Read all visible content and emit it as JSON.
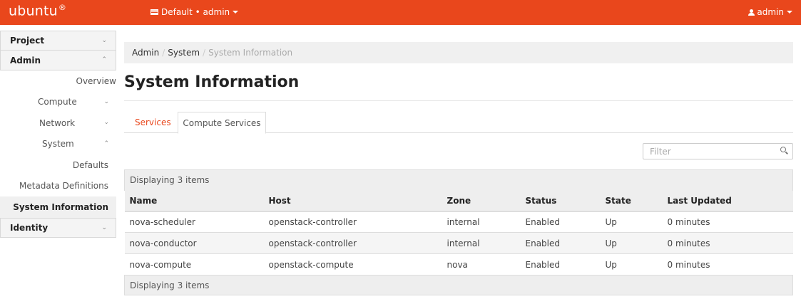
{
  "topbar": {
    "brand": "ubuntu",
    "brand_mark": "®",
    "context": "Default • admin",
    "user": "admin",
    "colors": {
      "accent": "#e9471c"
    }
  },
  "sidebar": {
    "sections": {
      "project": "Project",
      "admin": "Admin",
      "identity": "Identity"
    },
    "admin_items": {
      "overview": "Overview",
      "compute": "Compute",
      "network": "Network",
      "system": "System",
      "defaults": "Defaults",
      "metadata": "Metadata Definitions",
      "system_information": "System Information"
    }
  },
  "breadcrumb": {
    "admin": "Admin",
    "system": "System",
    "current": "System Information"
  },
  "page_title": "System Information",
  "tabs": {
    "services": "Services",
    "compute_services": "Compute Services"
  },
  "filter": {
    "placeholder": "Filter"
  },
  "table": {
    "info": "Displaying 3 items",
    "columns": [
      "Name",
      "Host",
      "Zone",
      "Status",
      "State",
      "Last Updated"
    ],
    "rows": [
      [
        "nova-scheduler",
        "openstack-controller",
        "internal",
        "Enabled",
        "Up",
        "0 minutes"
      ],
      [
        "nova-conductor",
        "openstack-controller",
        "internal",
        "Enabled",
        "Up",
        "0 minutes"
      ],
      [
        "nova-compute",
        "openstack-compute",
        "nova",
        "Enabled",
        "Up",
        "0 minutes"
      ]
    ],
    "footer": "Displaying 3 items"
  }
}
